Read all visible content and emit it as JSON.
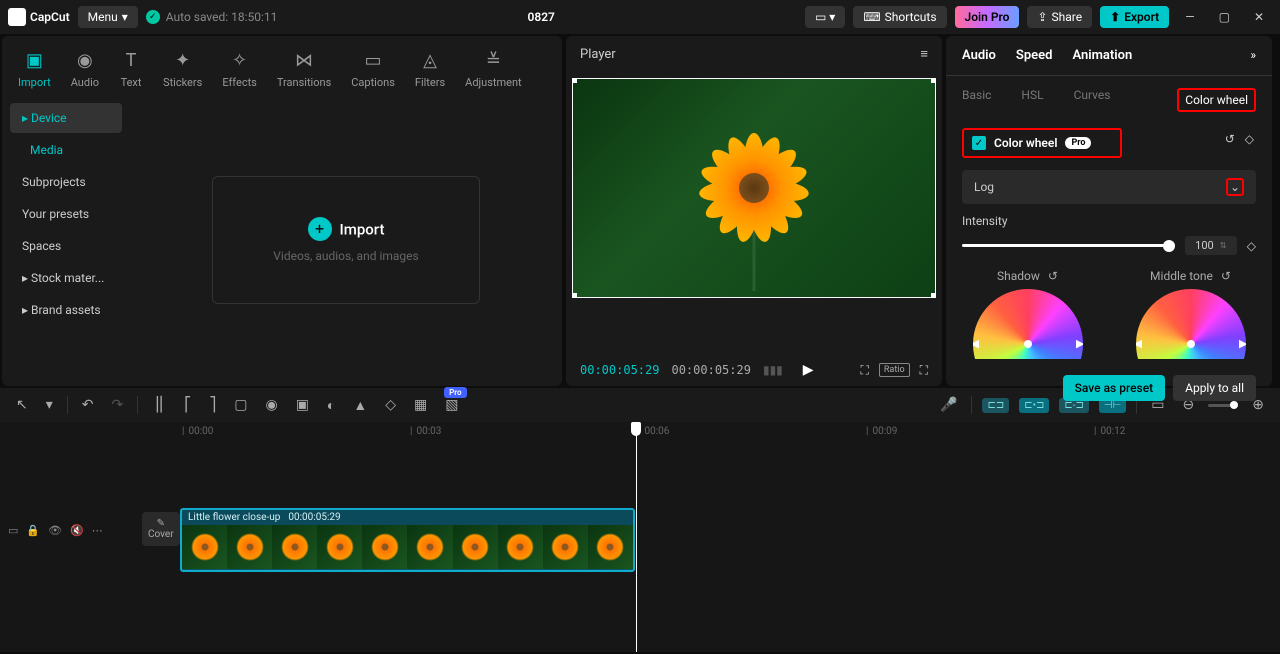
{
  "titlebar": {
    "app_name": "CapCut",
    "menu": "Menu",
    "autosaved": "Auto saved: 18:50:11",
    "project": "0827",
    "shortcuts": "Shortcuts",
    "join_pro": "Join Pro",
    "share": "Share",
    "export": "Export"
  },
  "tool_tabs": [
    "Import",
    "Audio",
    "Text",
    "Stickers",
    "Effects",
    "Transitions",
    "Captions",
    "Filters",
    "Adjustment"
  ],
  "left_nav": {
    "device": "Device",
    "media": "Media",
    "subprojects": "Subprojects",
    "presets": "Your presets",
    "spaces": "Spaces",
    "stock": "Stock mater...",
    "brand": "Brand assets"
  },
  "import_box": {
    "title": "Import",
    "sub": "Videos, audios, and images"
  },
  "player": {
    "title": "Player",
    "current": "00:00:05:29",
    "duration": "00:00:05:29",
    "ratio": "Ratio"
  },
  "right_panel": {
    "tabs": {
      "audio": "Audio",
      "speed": "Speed",
      "animation": "Animation"
    },
    "subtabs": {
      "basic": "Basic",
      "hsl": "HSL",
      "curves": "Curves",
      "colorwheel": "Color wheel"
    },
    "cw_label": "Color wheel",
    "pro": "Pro",
    "log": "Log",
    "intensity_label": "Intensity",
    "intensity_value": "100",
    "shadow": "Shadow",
    "midtone": "Middle tone",
    "save_preset": "Save as preset",
    "apply_all": "Apply to all"
  },
  "ruler": {
    "marks": [
      "00:00",
      "00:03",
      "00:06",
      "00:09",
      "00:12"
    ]
  },
  "clip": {
    "name": "Little flower close-up",
    "dur": "00:00:05:29"
  },
  "cover": "Cover",
  "pro_corner": "Pro"
}
